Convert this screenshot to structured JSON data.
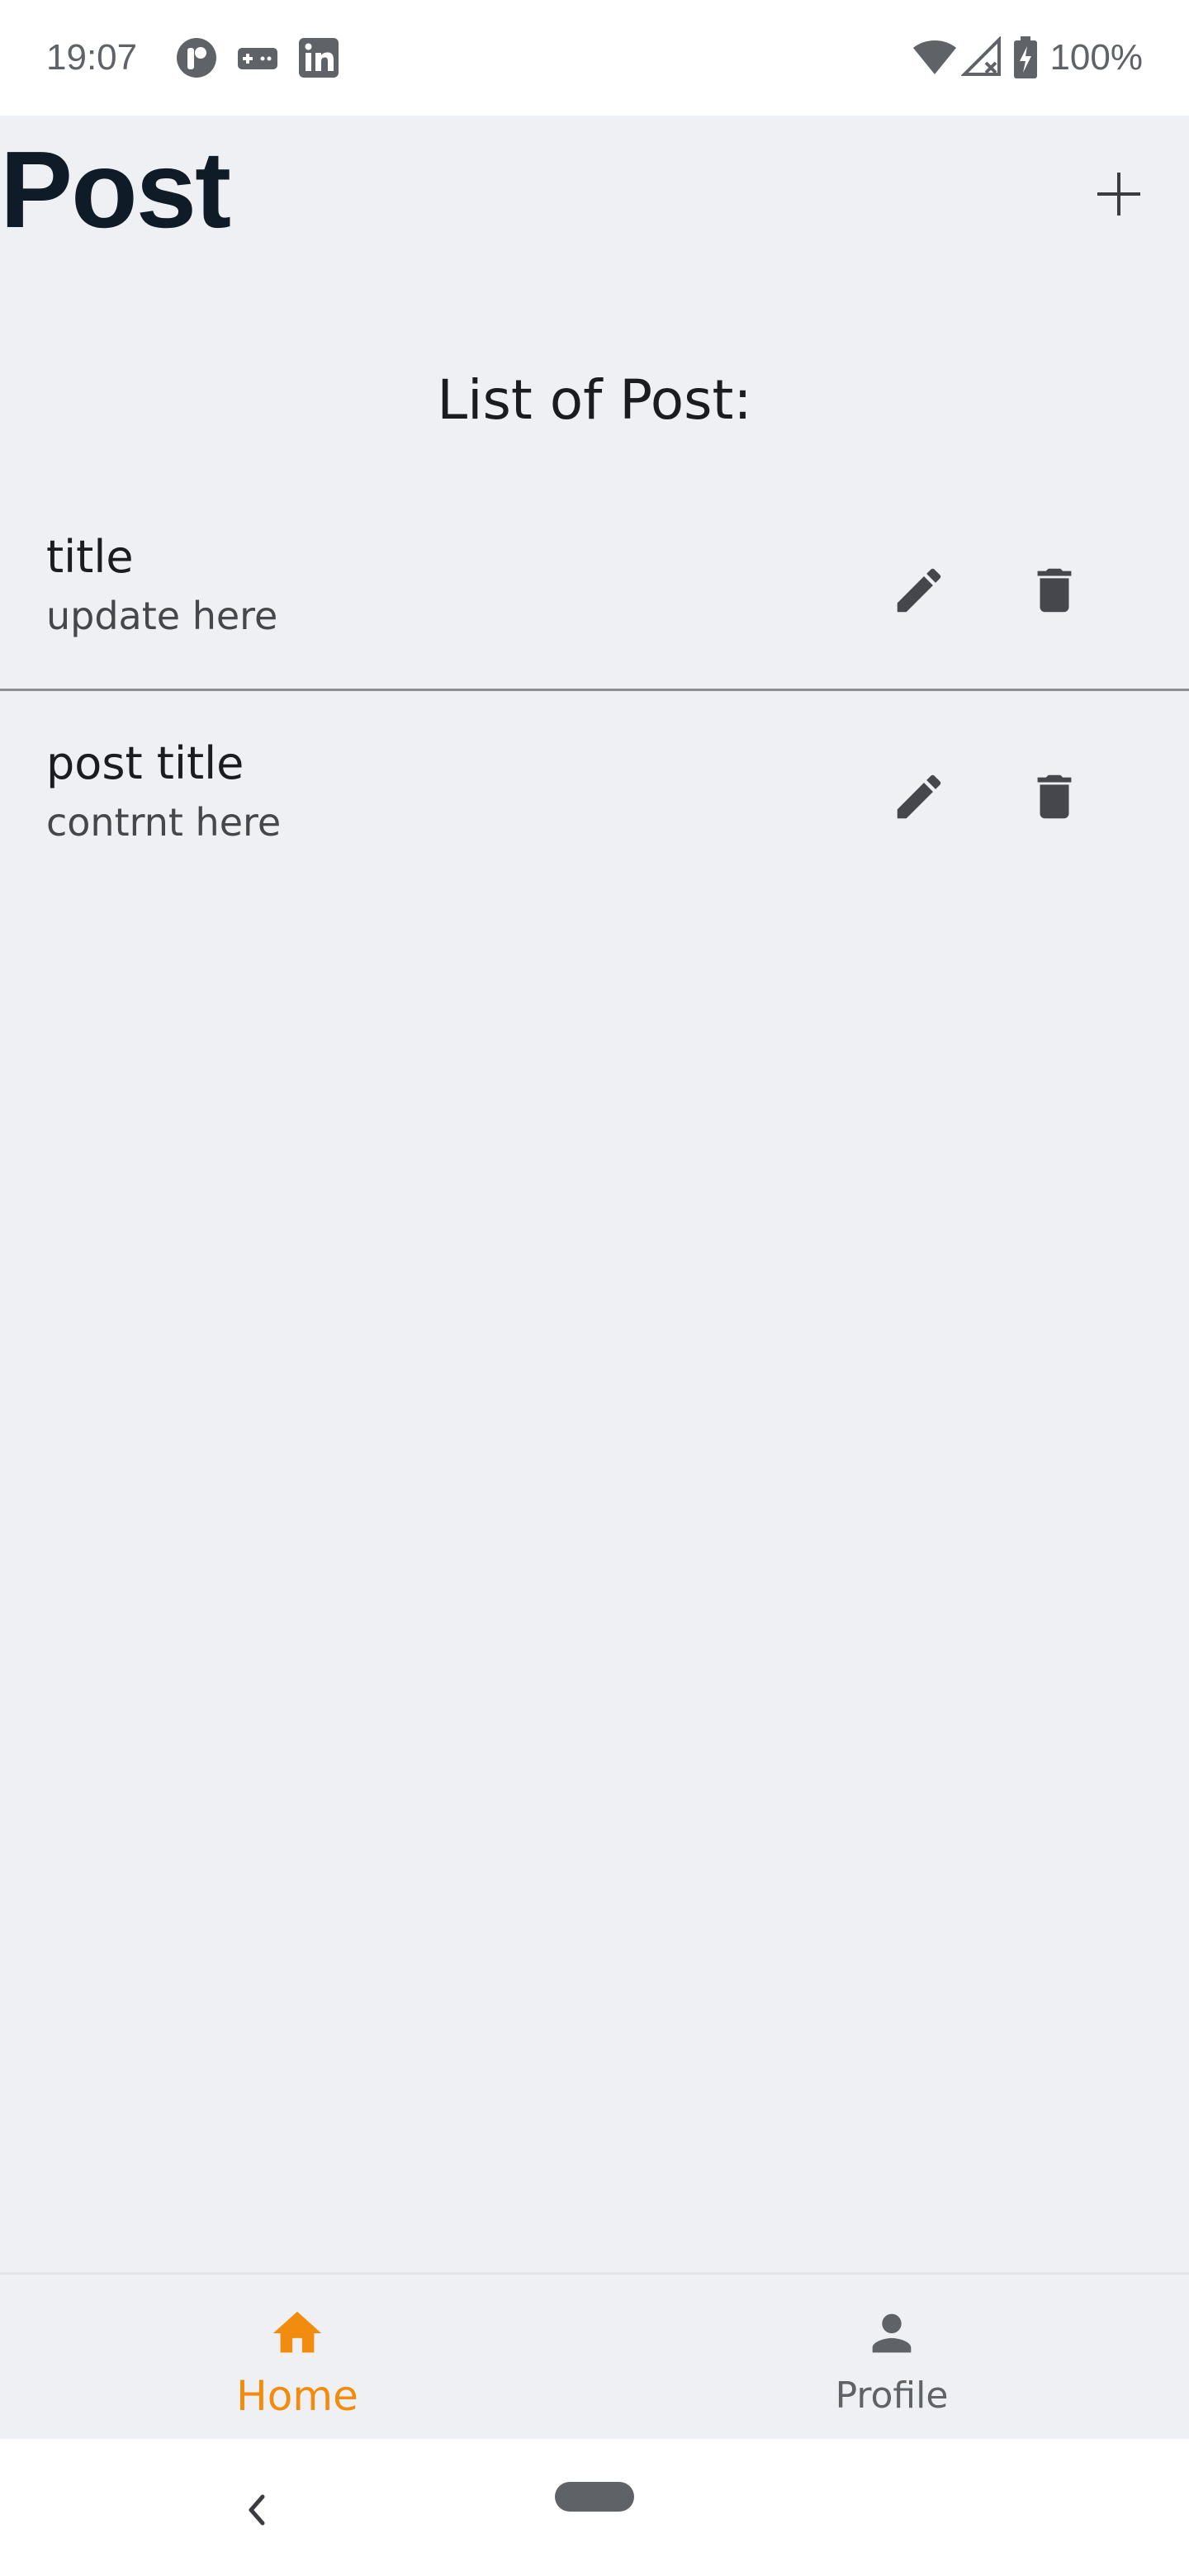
{
  "status_bar": {
    "time": "19:07",
    "battery": "100%",
    "icons": [
      "app-r-icon",
      "gamepad-icon",
      "linkedin-icon",
      "wifi-icon",
      "signal-icon",
      "battery-charging-icon"
    ]
  },
  "header": {
    "title": "Post",
    "add_icon": "plus-icon"
  },
  "list": {
    "heading": "List of Post:",
    "items": [
      {
        "title": "title",
        "subtitle": "update here"
      },
      {
        "title": "post title",
        "subtitle": "contrnt here"
      }
    ]
  },
  "bottom_nav": {
    "items": [
      {
        "label": "Home",
        "icon": "home-icon",
        "active": true
      },
      {
        "label": "Profile",
        "icon": "person-icon",
        "active": false
      }
    ]
  },
  "colors": {
    "background": "#eff0f4",
    "accent": "#f28c0f",
    "icon": "#45474c",
    "title": "#0f1b26"
  }
}
